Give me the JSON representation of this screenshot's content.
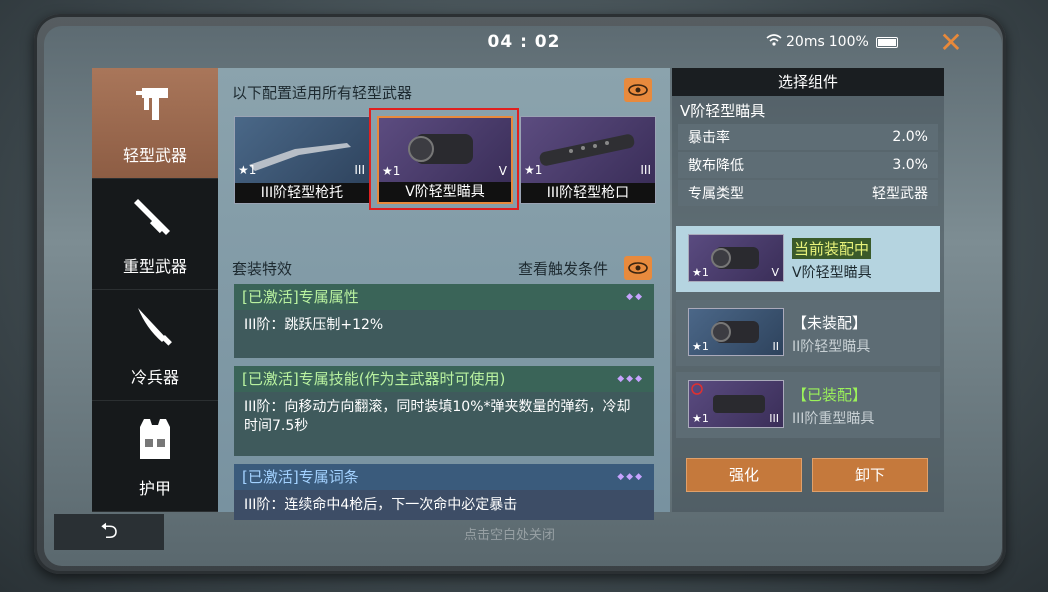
{
  "status": {
    "time": "04 : 02",
    "network": "20ms",
    "battery": "100%"
  },
  "nav": [
    {
      "label": "轻型武器",
      "icon": "smg-icon",
      "active": true
    },
    {
      "label": "重型武器",
      "icon": "launcher-icon",
      "active": false
    },
    {
      "label": "冷兵器",
      "icon": "knife-icon",
      "active": false
    },
    {
      "label": "护甲",
      "icon": "vest-icon",
      "active": false
    }
  ],
  "middle": {
    "apply_text": "以下配置适用所有轻型武器",
    "cards": [
      {
        "label": "III阶轻型枪托",
        "star": "★1",
        "tier": "III",
        "color": "blue"
      },
      {
        "label": "V阶轻型瞄具",
        "star": "★1",
        "tier": "V",
        "color": "purple"
      },
      {
        "label": "III阶轻型枪口",
        "star": "★1",
        "tier": "III",
        "color": "purple"
      }
    ],
    "set_title": "套装特效",
    "view_trigger": "查看触发条件",
    "effects": [
      {
        "head": "[已激活]专属属性",
        "body": "III阶：跳跃压制+12%"
      },
      {
        "head": "[已激活]专属技能(作为主武器时可使用)",
        "body": "III阶：向移动方向翻滚，同时装填10%*弹夹数量的弹药，冷却时间7.5秒"
      },
      {
        "head": "[已激活]专属词条",
        "body": "III阶：连续命中4枪后，下一次命中必定暴击"
      }
    ]
  },
  "right": {
    "title": "选择组件",
    "subtitle": "V阶轻型瞄具",
    "stats": [
      {
        "label": "暴击率",
        "value": "2.0%"
      },
      {
        "label": "散布降低",
        "value": "3.0%"
      },
      {
        "label": "专属类型",
        "value": "轻型武器"
      }
    ],
    "components": [
      {
        "status": "当前装配中",
        "name": "V阶轻型瞄具",
        "star": "★1",
        "tier": "V"
      },
      {
        "status": "【未装配】",
        "name": "II阶轻型瞄具",
        "star": "★1",
        "tier": "II"
      },
      {
        "status": "【已装配】",
        "name": "III阶重型瞄具",
        "star": "★1",
        "tier": "III"
      }
    ],
    "upgrade_label": "强化",
    "unequip_label": "卸下"
  },
  "bottom": {
    "back_icon": "back-arrow-icon",
    "close_hint": "点击空白处关闭"
  },
  "colors": {
    "accent": "#e88a3d",
    "nav_active": "#a9765a",
    "active_green": "#b9f2a0",
    "active_blue": "#a3d2ff"
  }
}
